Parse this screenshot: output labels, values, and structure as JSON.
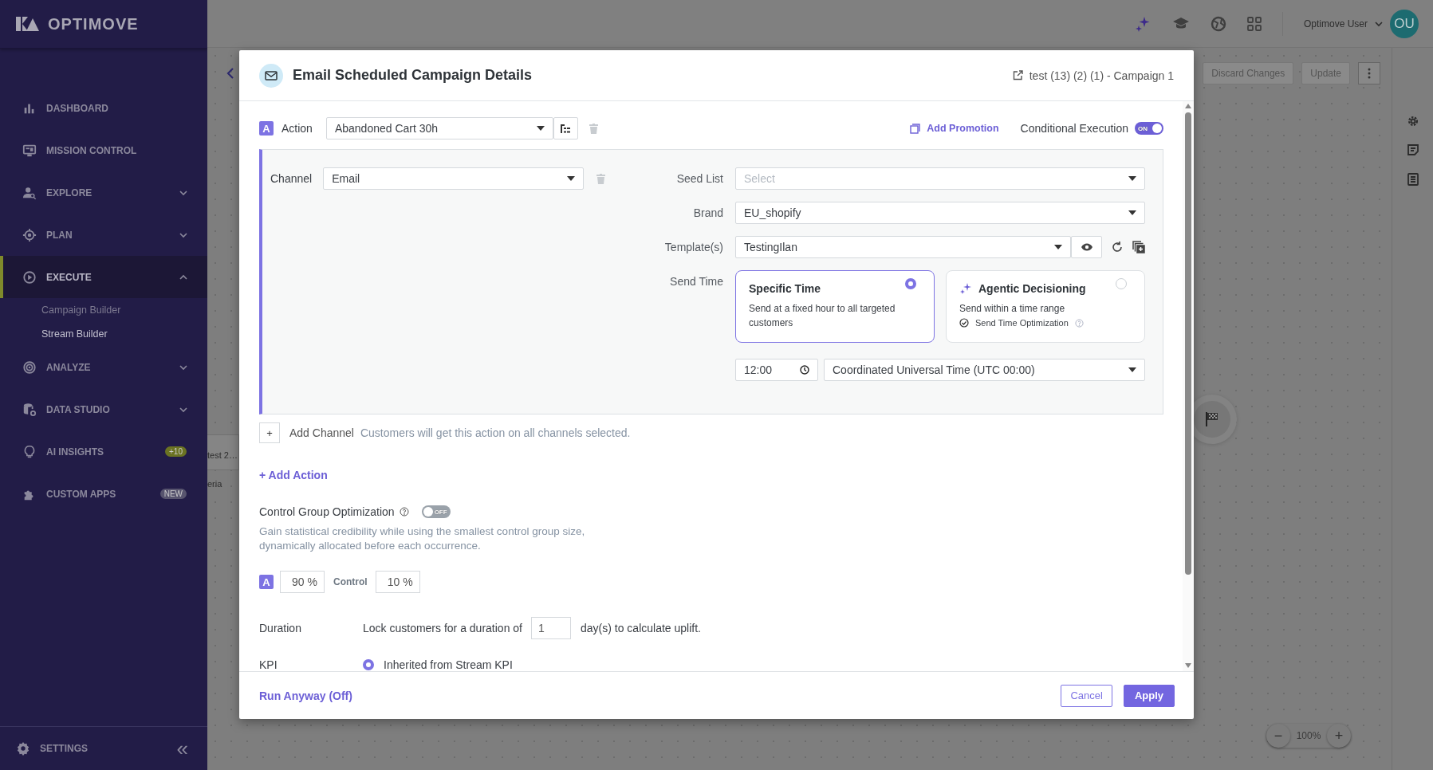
{
  "app": {
    "logo": "OPTIMOVE",
    "user_name": "Optimove User",
    "avatar": "OU"
  },
  "sidebar": {
    "items": [
      {
        "label": "DASHBOARD",
        "selected": false
      },
      {
        "label": "MISSION CONTROL",
        "selected": false
      },
      {
        "label": "EXPLORE",
        "selected": false,
        "expanded": false
      },
      {
        "label": "PLAN",
        "selected": false,
        "expanded": false
      },
      {
        "label": "EXECUTE",
        "selected": true,
        "expanded": true,
        "children": [
          {
            "label": "Campaign Builder",
            "selected": false
          },
          {
            "label": "Stream Builder",
            "selected": true
          }
        ]
      },
      {
        "label": "ANALYZE",
        "selected": false,
        "expanded": false
      },
      {
        "label": "DATA STUDIO",
        "selected": false,
        "expanded": false
      },
      {
        "label": "AI INSIGHTS",
        "selected": false,
        "badge": {
          "text": "+10",
          "color": "#6b7322"
        }
      },
      {
        "label": "CUSTOM APPS",
        "selected": false,
        "badge": {
          "text": "NEW",
          "color": "#57546e"
        }
      }
    ],
    "settings": "SETTINGS",
    "collapse": "«"
  },
  "canvas": {
    "toolbar": [
      {
        "label": "Discard Changes",
        "disabled": true
      },
      {
        "label": "Update",
        "disabled": true
      }
    ],
    "node_texts": [
      "test 2…",
      "eria"
    ],
    "zoom": {
      "minus": "−",
      "value": "100%",
      "plus": "+"
    }
  },
  "modal": {
    "title": "Email Scheduled Campaign Details",
    "campaign_link": "test (13) (2) (1) - Campaign 1",
    "action": {
      "badge": "A",
      "label": "Action",
      "value": "Abandoned Cart 30h"
    },
    "add_promotion": "Add Promotion",
    "conditional_execution": {
      "label": "Conditional Execution",
      "on": true,
      "toggle_text": "ON"
    },
    "channel": {
      "label": "Channel",
      "value": "Email"
    },
    "fields": [
      {
        "label": "Seed List",
        "placeholder": "Select"
      },
      {
        "label": "Brand",
        "value": "EU_shopify"
      },
      {
        "label": "Template(s)",
        "value": "TestingIlan"
      }
    ],
    "send_time": {
      "label": "Send Time",
      "options": [
        {
          "title": "Specific Time",
          "description": "Send at a fixed hour to all targeted customers",
          "selected": true
        },
        {
          "title": "Agentic Decisioning",
          "description": "Send within a time range",
          "feature": "Send Time Optimization",
          "selected": false
        }
      ],
      "time": "12:00",
      "timezone": "Coordinated Universal Time (UTC 00:00)"
    },
    "add_channel": {
      "button": "+",
      "label": "Add Channel",
      "hint": "Customers will get this action on all channels selected."
    },
    "add_action": "+ Add Action",
    "control_group": {
      "label": "Control Group Optimization",
      "on": false,
      "toggle_text": "OFF",
      "description_lines": [
        "Gain statistical credibility while using the smallest control group size,",
        "dynamically allocated before each occurrence."
      ],
      "split": [
        {
          "label": "A",
          "value": "90 %"
        },
        {
          "label": "Control",
          "value": "10 %"
        }
      ]
    },
    "duration": {
      "label": "Duration",
      "before": "Lock customers for a duration of",
      "value": "1",
      "after": "day(s) to calculate uplift."
    },
    "kpi": {
      "label": "KPI",
      "options": [
        {
          "label": "Inherited from Stream KPI",
          "selected": true
        }
      ]
    },
    "footer": {
      "run_anyway": "Run Anyway (Off)",
      "buttons": [
        {
          "label": "Cancel",
          "kind": "secondary"
        },
        {
          "label": "Apply",
          "kind": "primary"
        }
      ]
    }
  }
}
